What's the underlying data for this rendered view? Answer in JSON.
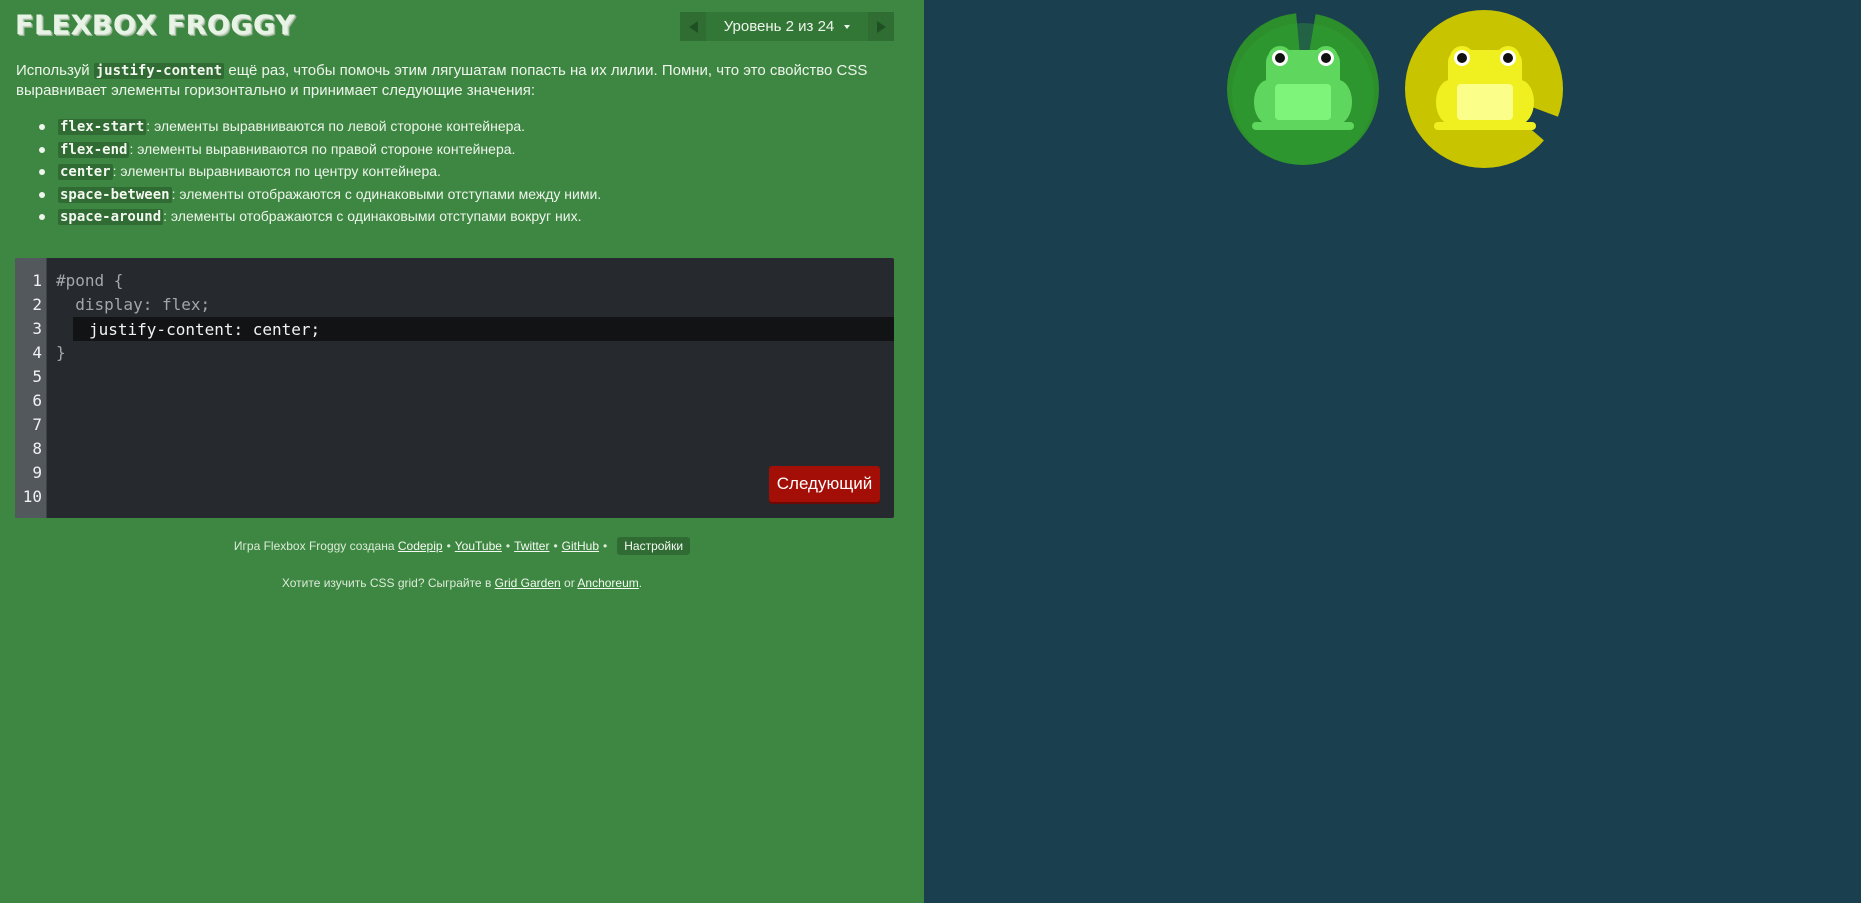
{
  "app": {
    "title": "FLEXBOX FROGGY"
  },
  "level_nav": {
    "label": "Уровень 2 из 24"
  },
  "instructions": {
    "pre": "Используй ",
    "keyword": "justify-content",
    "post": " ещё раз, чтобы помочь этим лягушатам попасть на их лилии. Помни, что это свойство CSS выравнивает элементы горизонтально и принимает следующие значения:"
  },
  "properties": [
    {
      "name": "flex-start",
      "desc": ": элементы выравниваются по левой стороне контейнера."
    },
    {
      "name": "flex-end",
      "desc": ": элементы выравниваются по правой стороне контейнера."
    },
    {
      "name": "center",
      "desc": ": элементы выравниваются по центру контейнера."
    },
    {
      "name": "space-between",
      "desc": ": элементы отображаются с одинаковыми отступами между ними."
    },
    {
      "name": "space-around",
      "desc": ": элементы отображаются с одинаковыми отступами вокруг них."
    }
  ],
  "editor": {
    "line_numbers": [
      "1",
      "2",
      "3",
      "4",
      "5",
      "6",
      "7",
      "8",
      "9",
      "10"
    ],
    "line1": "#pond {",
    "line2": "  display: flex;",
    "input_value": "justify-content: center;",
    "line4": "}",
    "next_button": "Следующий"
  },
  "credits": {
    "text": "Игра Flexbox Froggy создана",
    "codepip": "Codepip",
    "youtube": "YouTube",
    "twitter": "Twitter",
    "github": "GitHub",
    "bullet": "•",
    "settings": "Настройки"
  },
  "more": {
    "text": "Хотите изучить CSS grid? Сыграйте в",
    "grid_garden": "Grid Garden",
    "or": "or",
    "anchoreum": "Anchoreum",
    "end": "."
  },
  "colors": {
    "left_panel": "#3e8742",
    "pond": "#1a3f4f",
    "green_frog": "#5fd65d",
    "yellow_frog": "#f0f020",
    "next_button": "#a30e06"
  }
}
